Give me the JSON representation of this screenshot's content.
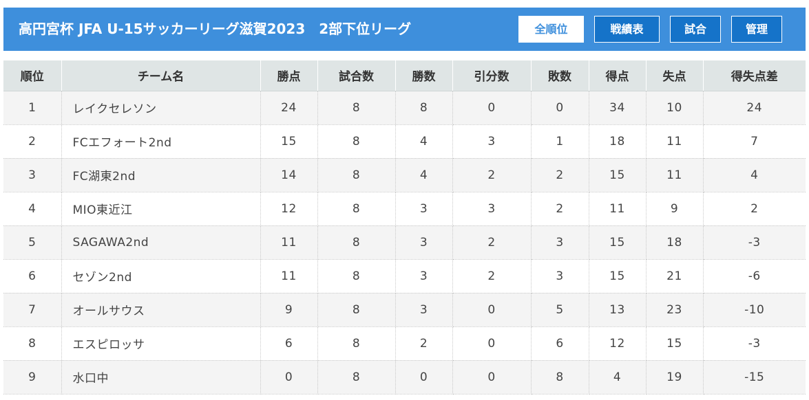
{
  "header": {
    "title": "高円宮杯 JFA U-15サッカーリーグ滋賀2023　2部下位リーグ",
    "nav": [
      {
        "label": "全順位",
        "active": true
      },
      {
        "label": "戦績表",
        "active": false
      },
      {
        "label": "試合",
        "active": false
      },
      {
        "label": "管理",
        "active": false
      }
    ]
  },
  "colors": {
    "header_bg": "#3e8fdc",
    "nav_inactive_bg": "#1573c9",
    "table_header_bg": "#dfe5e5",
    "row_stripe": "#f4f4f4"
  },
  "table": {
    "columns": [
      "順位",
      "チーム名",
      "勝点",
      "試合数",
      "勝数",
      "引分数",
      "敗数",
      "得点",
      "失点",
      "得失点差"
    ],
    "rows": [
      [
        "1",
        "レイクセレソン",
        "24",
        "8",
        "8",
        "0",
        "0",
        "34",
        "10",
        "24"
      ],
      [
        "2",
        "FCエフォート2nd",
        "15",
        "8",
        "4",
        "3",
        "1",
        "18",
        "11",
        "7"
      ],
      [
        "3",
        "FC湖東2nd",
        "14",
        "8",
        "4",
        "2",
        "2",
        "15",
        "11",
        "4"
      ],
      [
        "4",
        "MIO東近江",
        "12",
        "8",
        "3",
        "3",
        "2",
        "11",
        "9",
        "2"
      ],
      [
        "5",
        "SAGAWA2nd",
        "11",
        "8",
        "3",
        "2",
        "3",
        "15",
        "18",
        "-3"
      ],
      [
        "6",
        "セゾン2nd",
        "11",
        "8",
        "3",
        "2",
        "3",
        "15",
        "21",
        "-6"
      ],
      [
        "7",
        "オールサウス",
        "9",
        "8",
        "3",
        "0",
        "5",
        "13",
        "23",
        "-10"
      ],
      [
        "8",
        "エスピロッサ",
        "6",
        "8",
        "2",
        "0",
        "6",
        "12",
        "15",
        "-3"
      ],
      [
        "9",
        "水口中",
        "0",
        "8",
        "0",
        "0",
        "8",
        "4",
        "19",
        "-15"
      ]
    ]
  }
}
